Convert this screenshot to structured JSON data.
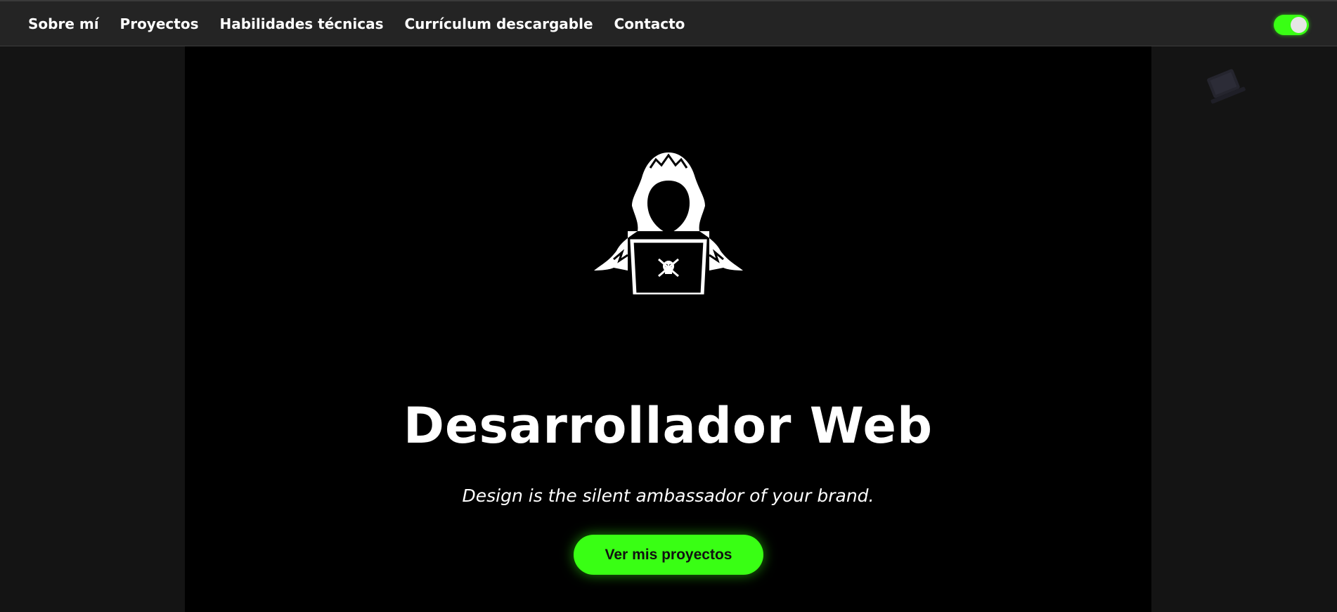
{
  "nav": {
    "items": [
      {
        "label": "Sobre mí"
      },
      {
        "label": "Proyectos"
      },
      {
        "label": "Habilidades técnicas"
      },
      {
        "label": "Currículum descargable"
      },
      {
        "label": "Contacto"
      }
    ]
  },
  "theme_toggle": {
    "state": "on",
    "color": "#39FF14"
  },
  "hero": {
    "title": "Desarrollador Web",
    "tagline": "Design is the silent ambassador of your brand.",
    "cta_label": "Ver mis proyectos",
    "cta_color": "#39FF14",
    "icon": "hooded-hacker-laptop-skull-icon"
  },
  "decorations": {
    "left_icon": "circuit-board-icon",
    "right_icon": "laptop-icon"
  }
}
